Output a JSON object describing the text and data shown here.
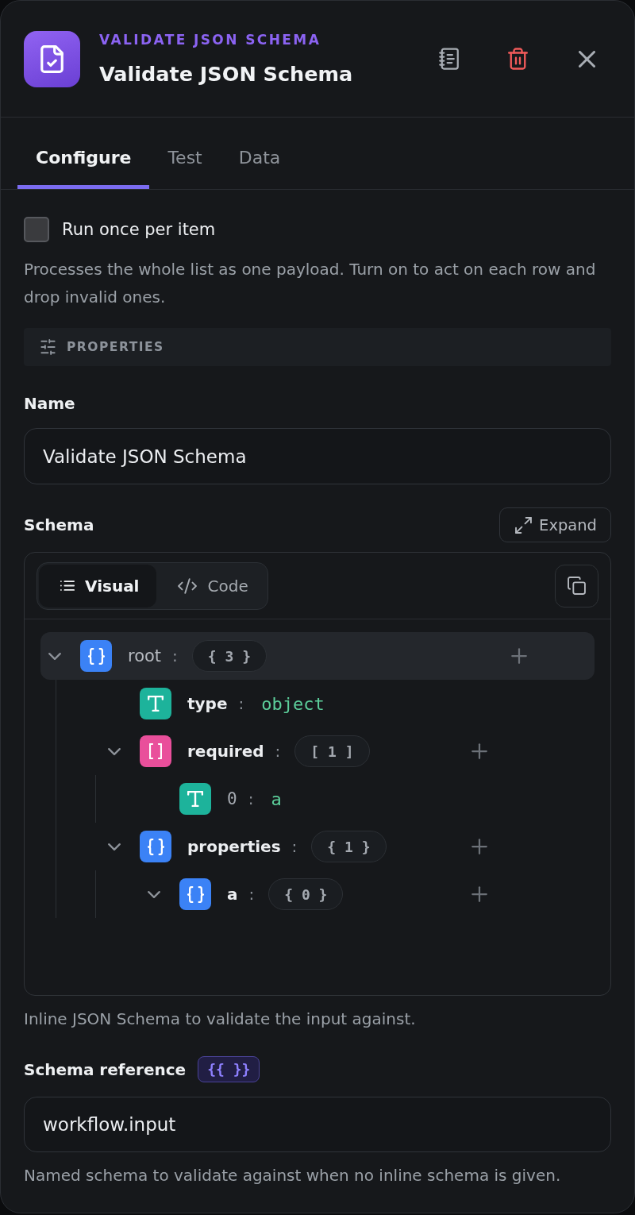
{
  "header": {
    "kicker": "VALIDATE JSON SCHEMA",
    "title": "Validate JSON Schema"
  },
  "tabs": [
    {
      "label": "Configure",
      "selected": true
    },
    {
      "label": "Test",
      "selected": false
    },
    {
      "label": "Data",
      "selected": false
    }
  ],
  "run_once": {
    "label": "Run once per item",
    "checked": false,
    "description": "Processes the whole list as one payload. Turn on to act on each row and drop invalid ones."
  },
  "section": {
    "title": "PROPERTIES"
  },
  "name_field": {
    "label": "Name",
    "value": "Validate JSON Schema"
  },
  "schema": {
    "label": "Schema",
    "expand_label": "Expand",
    "modes": [
      {
        "label": "Visual",
        "kind": "visual",
        "selected": true
      },
      {
        "label": "Code",
        "kind": "code",
        "selected": false
      }
    ],
    "tree": {
      "key": "root",
      "separator": ":",
      "kind": "object",
      "count": "{ 3 }",
      "expanded": true,
      "selected": true,
      "children": [
        {
          "key": "type",
          "separator": ":",
          "kind": "string",
          "value": "object",
          "selected": false
        },
        {
          "key": "required",
          "separator": ":",
          "kind": "array",
          "count": "[ 1 ]",
          "expanded": true,
          "selected": false,
          "children": [
            {
              "key": "0",
              "separator": ":",
              "kind": "string",
              "value": "a",
              "selected": false
            }
          ]
        },
        {
          "key": "properties",
          "separator": ":",
          "kind": "object",
          "count": "{ 1 }",
          "expanded": true,
          "selected": false,
          "children": [
            {
              "key": "a",
              "separator": ":",
              "kind": "object",
              "count": "{ 0 }",
              "expanded": true,
              "selected": false
            }
          ]
        }
      ]
    },
    "help": "Inline JSON Schema to validate the input against."
  },
  "schema_reference": {
    "label": "Schema reference",
    "badge": "{{ }}",
    "value": "workflow.input",
    "help": "Named schema to validate against when no inline schema is given."
  }
}
